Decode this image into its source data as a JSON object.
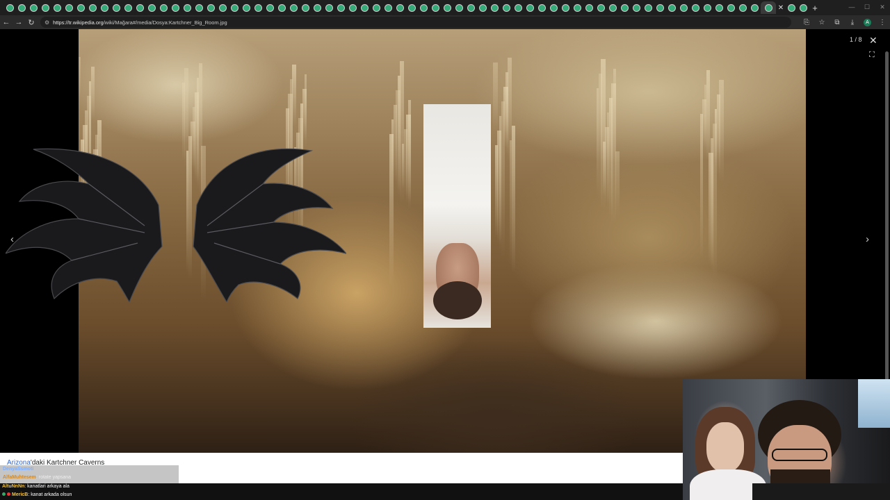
{
  "browser": {
    "url": "https://tr.wikipedia.org/wiki/Mağara#/media/Dosya:Kartchner_Big_Room.jpg",
    "url_host": "https://tr.wikipedia.org",
    "url_path": "/wiki/Mağara#/media/Dosya:Kartchner_Big_Room.jpg",
    "profile_initial": "A",
    "tab_count": 67
  },
  "viewer": {
    "counter": "1 / 8",
    "caption_link": "Arizona",
    "caption_rest": "'daki Kartchner Caverns"
  },
  "chat": {
    "faded": [
      {
        "user": "DenyaSsmoti",
        "text": ""
      },
      {
        "user": "AlfaMuhtesem",
        "text": ": rotate yapsana"
      }
    ],
    "messages": [
      {
        "user": "AltuNnNn",
        "text": ": kanatlari arkaya ala"
      },
      {
        "user": "MericB",
        "text": ": kanat arkada olsun"
      }
    ]
  },
  "colors": {
    "link": "#3366cc",
    "toolbar": "#2b2b2b",
    "tabstrip": "#1f1f1f"
  }
}
